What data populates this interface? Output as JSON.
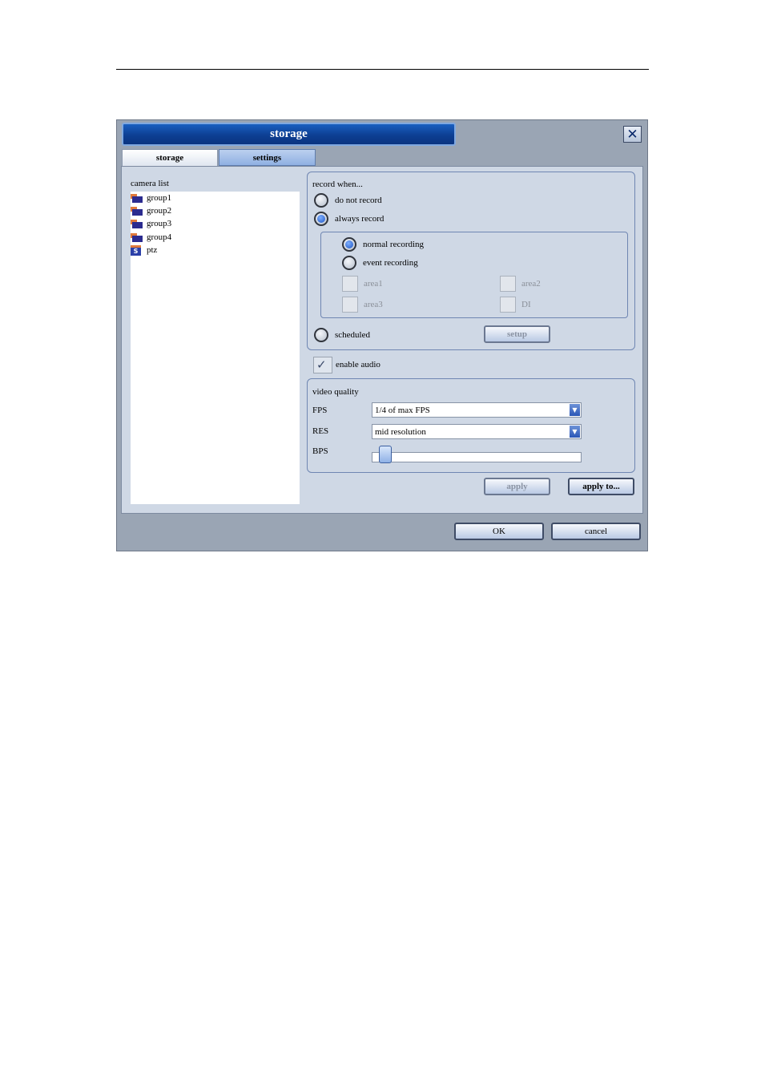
{
  "window": {
    "title": "storage"
  },
  "tabs": [
    {
      "label": "storage",
      "active": true
    },
    {
      "label": "settings",
      "active": false
    }
  ],
  "camera_list": {
    "label": "camera list",
    "items": [
      {
        "label": "group1",
        "icon": "camera-group-icon"
      },
      {
        "label": "group2",
        "icon": "camera-group-icon"
      },
      {
        "label": "group3",
        "icon": "camera-group-icon"
      },
      {
        "label": "group4",
        "icon": "camera-group-icon"
      },
      {
        "label": "ptz",
        "icon": "ptz-camera-icon"
      }
    ]
  },
  "record_when": {
    "label": "record when...",
    "options": {
      "do_not_record": "do not record",
      "always_record": "always record",
      "scheduled": "scheduled"
    },
    "selected": "always_record",
    "sub": {
      "normal_recording": "normal recording",
      "event_recording": "event recording",
      "selected": "normal_recording",
      "areas": {
        "area1": "area1",
        "area2": "area2",
        "area3": "area3",
        "di": "DI"
      }
    },
    "setup_label": "setup"
  },
  "enable_audio": {
    "label": "enable audio",
    "checked": true
  },
  "video_quality": {
    "label": "video quality",
    "fps_label": "FPS",
    "fps_value": "1/4 of max FPS",
    "res_label": "RES",
    "res_value": "mid resolution",
    "bps_label": "BPS"
  },
  "buttons": {
    "apply": "apply",
    "apply_to": "apply to...",
    "ok": "OK",
    "cancel": "cancel"
  }
}
